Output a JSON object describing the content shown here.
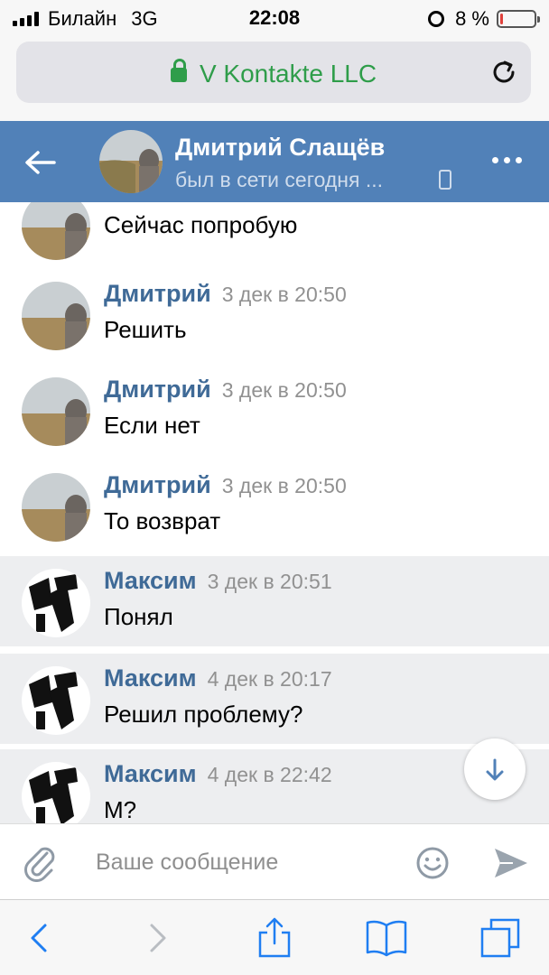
{
  "status_bar": {
    "carrier": "Билайн",
    "network": "3G",
    "time": "22:08",
    "battery_percent": "8 %",
    "battery_level": 0.08
  },
  "browser": {
    "url_title": "V Kontakte LLC",
    "lock_icon": "lock-icon",
    "reload_icon": "reload-icon"
  },
  "chat_header": {
    "name": "Дмитрий Слащёв",
    "status": "был в сети сегодня ...",
    "back_icon": "arrow-left-icon",
    "more_icon": "more-dots-icon",
    "accent_color": "#5181b8"
  },
  "messages": [
    {
      "author": "Дмитрий",
      "time": "3 дек в 20:50",
      "text": "Сейчас попробую",
      "outgoing": false
    },
    {
      "author": "Дмитрий",
      "time": "3 дек в 20:50",
      "text": "Решить",
      "outgoing": false
    },
    {
      "author": "Дмитрий",
      "time": "3 дек в 20:50",
      "text": "Если нет",
      "outgoing": false
    },
    {
      "author": "Дмитрий",
      "time": "3 дек в 20:50",
      "text": "То возврат",
      "outgoing": false
    },
    {
      "author": "Максим",
      "time": "3 дек в 20:51",
      "text": "Понял",
      "outgoing": true
    },
    {
      "author": "Максим",
      "time": "4 дек в 20:17",
      "text": "Решил проблему?",
      "outgoing": true
    },
    {
      "author": "Максим",
      "time": "4 дек в 22:42",
      "text": "М?",
      "outgoing": true
    }
  ],
  "composer": {
    "placeholder": "Ваше сообщение",
    "attach_icon": "paperclip-icon",
    "emoji_icon": "smile-icon",
    "send_icon": "send-icon"
  },
  "toolbar": {
    "icons": [
      "chevron-left-icon",
      "chevron-right-icon",
      "share-icon",
      "bookmarks-icon",
      "tabs-icon"
    ]
  }
}
